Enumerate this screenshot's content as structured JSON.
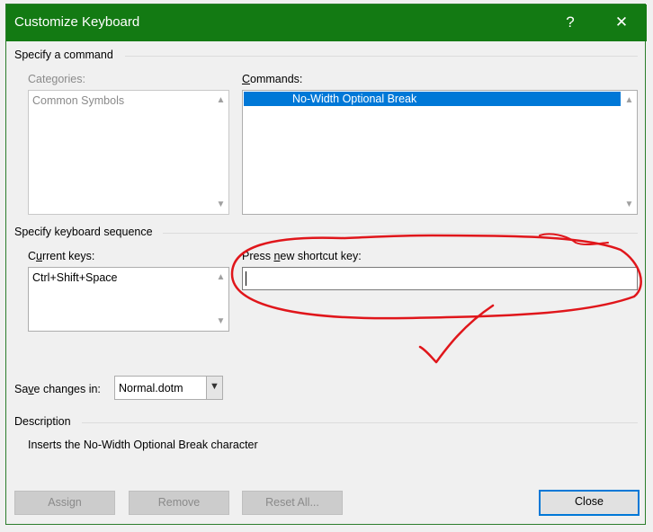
{
  "window": {
    "title": "Customize Keyboard",
    "help_glyph": "?",
    "close_glyph": "✕"
  },
  "specify_command": {
    "heading": "Specify a command",
    "categories_label": "Categories:",
    "categories_items": [
      "Common Symbols"
    ],
    "commands_label": "Commands:",
    "commands_items": [
      "No-Width Optional Break"
    ]
  },
  "keyboard_sequence": {
    "heading": "Specify keyboard sequence",
    "current_keys_label": "Current keys:",
    "current_keys_items": [
      "Ctrl+Shift+Space"
    ],
    "new_shortcut_label": "Press new shortcut key:",
    "new_shortcut_value": ""
  },
  "save_changes": {
    "label": "Save changes in:",
    "value": "Normal.dotm"
  },
  "description": {
    "heading": "Description",
    "text": "Inserts the No-Width Optional Break character"
  },
  "buttons": {
    "assign": "Assign",
    "remove": "Remove",
    "reset_all": "Reset All...",
    "close": "Close"
  },
  "colors": {
    "titlebar": "#137a13",
    "selection": "#0078d7",
    "annotation": "#e0161b"
  },
  "icons": {
    "scroll_up": "chevron-up-icon",
    "scroll_down": "chevron-down-icon",
    "dropdown": "chevron-down-icon"
  }
}
